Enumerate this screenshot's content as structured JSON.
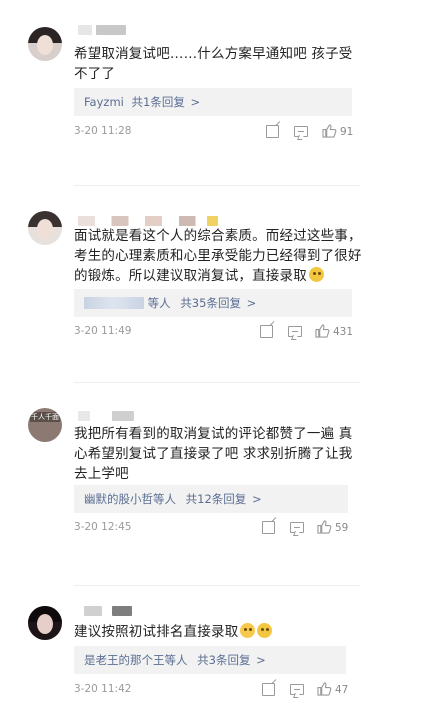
{
  "colors": {
    "link": "#5b6e92",
    "meta": "#9a9a9a",
    "reply_bg": "#f2f2f2",
    "text": "#222222"
  },
  "comments": [
    {
      "text": "希望取消复试吧……什么方案早通知吧  孩子受不了了",
      "reply_user": "Fayzmi",
      "reply_count_text": "共1条回复",
      "reply_arrow": ">",
      "time": "3-20 11:28",
      "likes": "91"
    },
    {
      "text": "面试就是看这个人的综合素质。而经过这些事，考生的心理素质和心里承受能力已经得到了很好的锻炼。所以建议取消复试，直接录取",
      "reply_user": "等人",
      "reply_count_text": "共35条回复",
      "reply_arrow": ">",
      "time": "3-20 11:49",
      "likes": "431"
    },
    {
      "avatar_badge": "千人千面",
      "text": "我把所有看到的取消复试的评论都赞了一遍 真心希望别复试了直接录了吧 求求别折腾了让我去上学吧",
      "reply_user": "幽默的股小哲等人",
      "reply_count_text": "共12条回复",
      "reply_arrow": ">",
      "time": "3-20 12:45",
      "likes": "59"
    },
    {
      "text": "建议按照初试排名直接录取",
      "reply_user": "是老王的那个王等人",
      "reply_count_text": "共3条回复",
      "reply_arrow": ">",
      "time": "3-20 11:42",
      "likes": "47"
    }
  ],
  "icons": {
    "share": "share-icon",
    "comment": "comment-icon",
    "like": "like-icon",
    "emoji": "emoji-icon"
  }
}
